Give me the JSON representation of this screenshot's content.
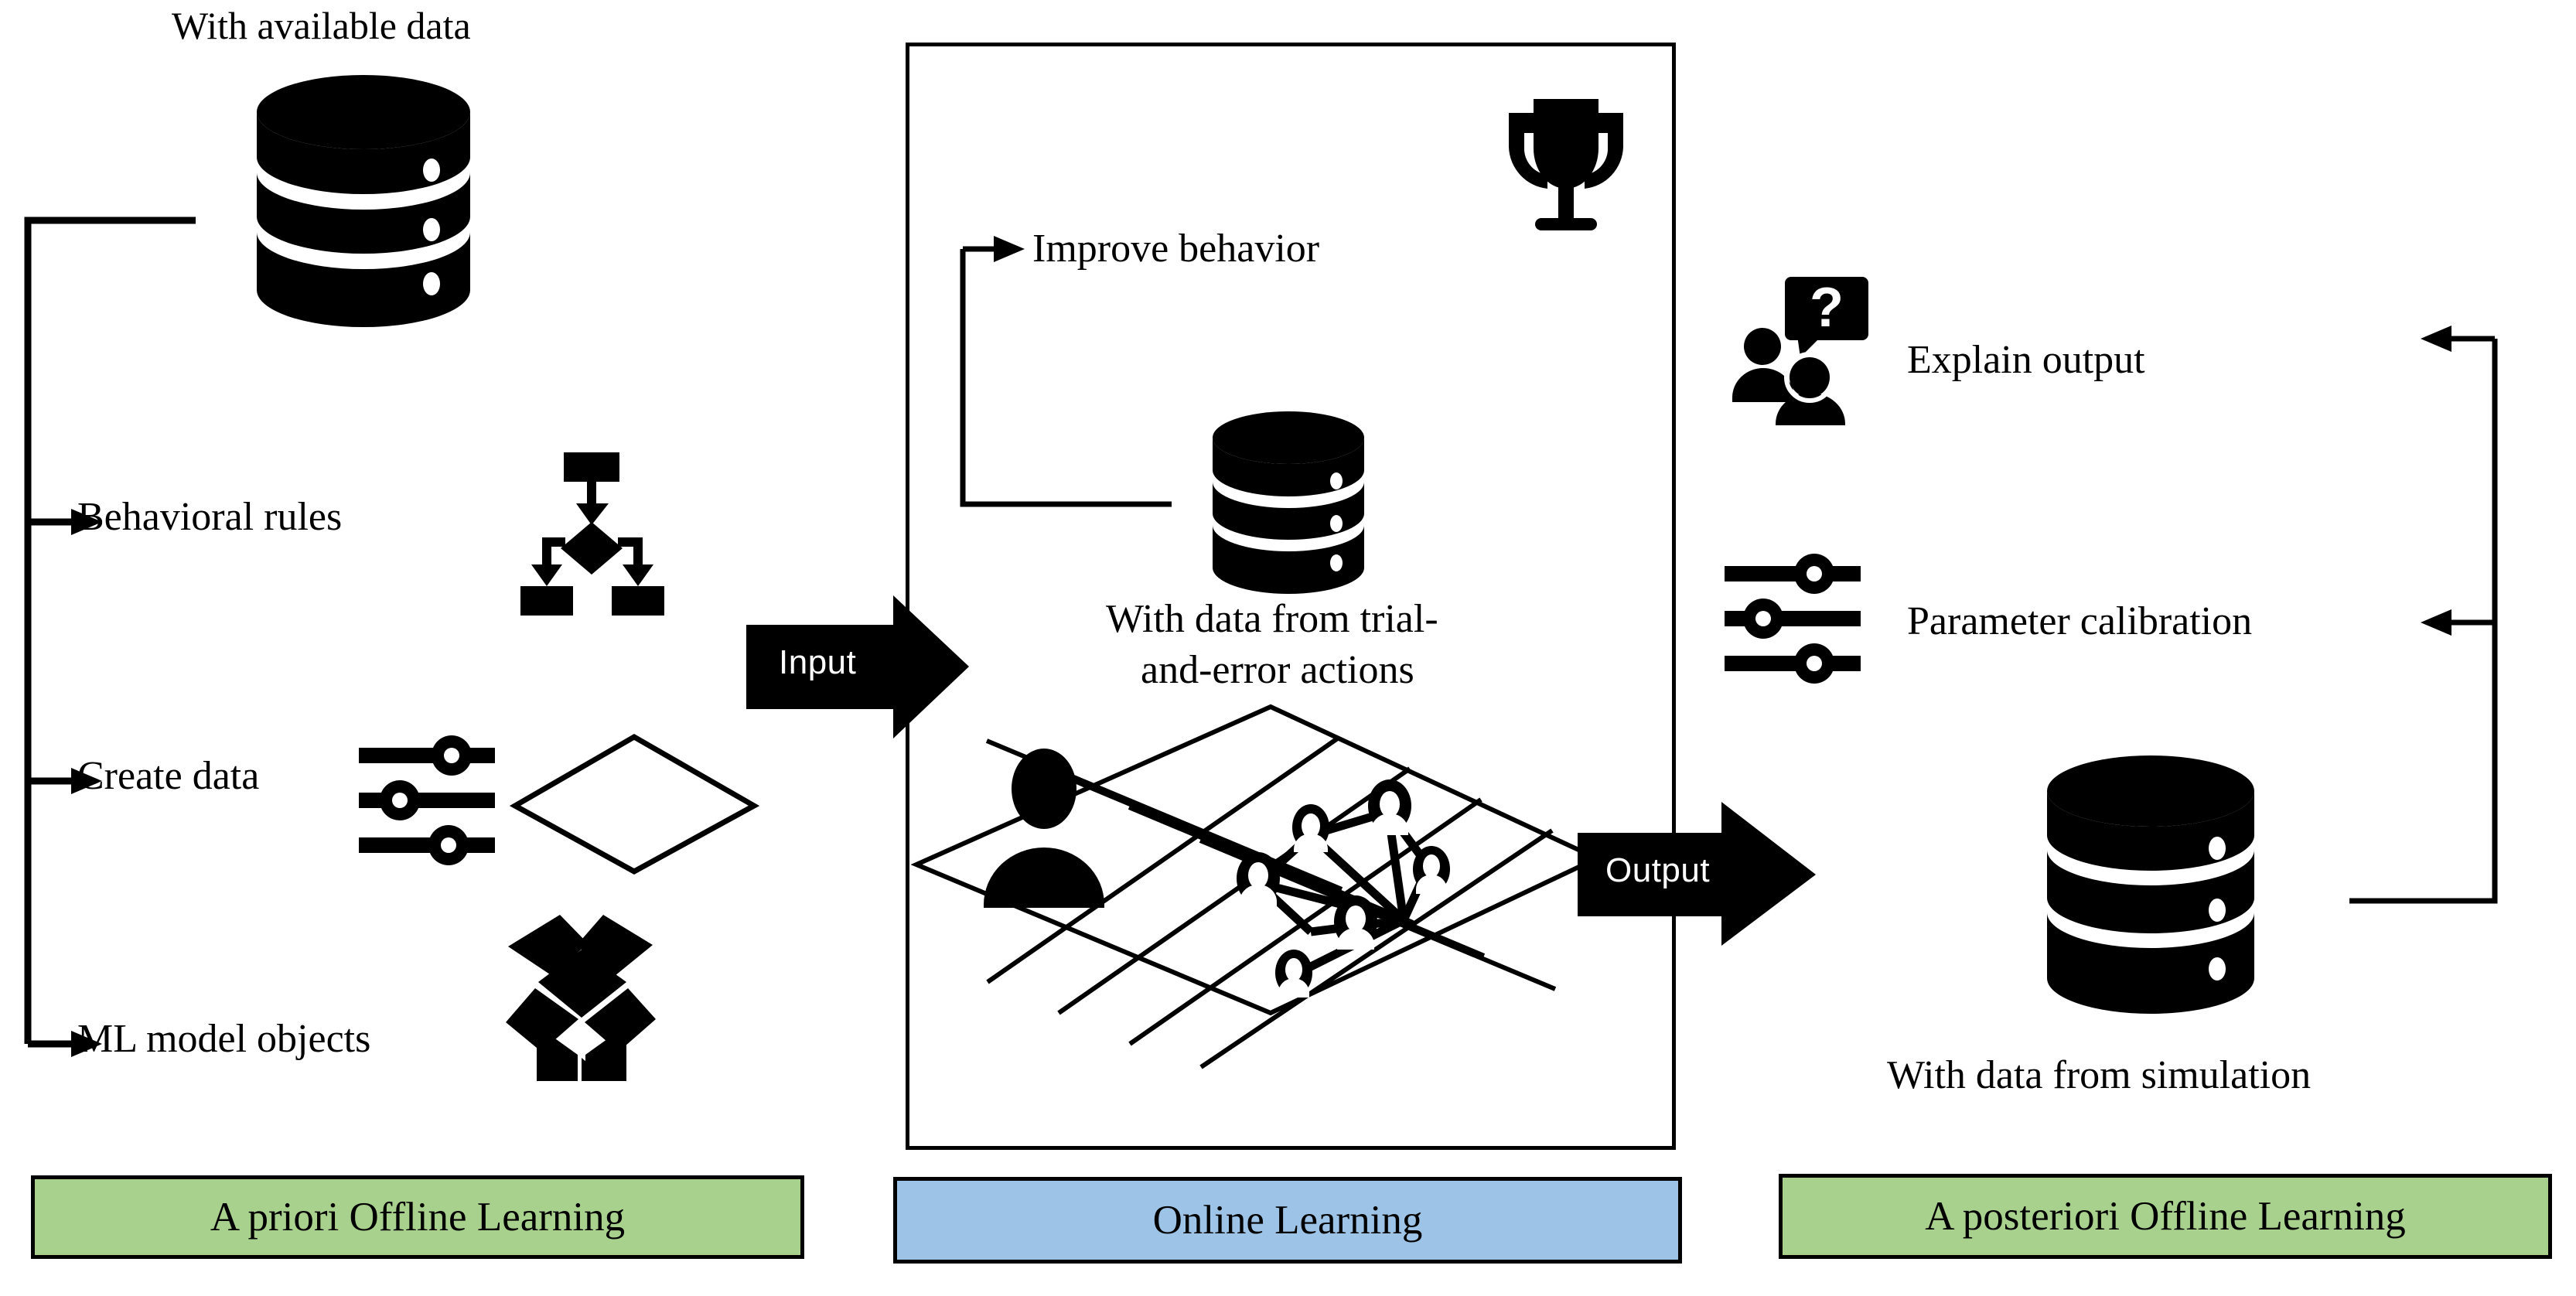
{
  "diagram": {
    "title_hidden": "Agent-based learning pipeline",
    "left_column": {
      "header_label": "With available data",
      "items": [
        {
          "label": "Behavioral rules",
          "icon": "flowchart-icon"
        },
        {
          "label": "Create data",
          "icon": "sliders-icon"
        },
        {
          "label": "ML model objects",
          "icon": "open-box-icon"
        }
      ],
      "database_icon": "database-icon",
      "diamond_icon": "diamond-outline-icon",
      "banner_label": "A priori Offline Learning",
      "banner_color": "#A9D18E"
    },
    "center_column": {
      "feedback_label": "Improve behavior",
      "trophy_icon": "trophy-icon",
      "database_icon": "database-icon",
      "database_caption_line1": "With data from trial-",
      "database_caption_line2": "and-error actions",
      "grid_icon": "isometric-grid-icon",
      "person_icon": "person-icon",
      "agent_network_icon": "agent-network-icon",
      "banner_label": "Online Learning",
      "banner_color": "#9DC3E6"
    },
    "right_column": {
      "items": [
        {
          "label": "Explain output",
          "icon": "people-question-icon"
        },
        {
          "label": "Parameter calibration",
          "icon": "sliders-icon"
        }
      ],
      "database_icon": "database-icon",
      "database_caption": "With data from simulation",
      "banner_label": "A posteriori Offline Learning",
      "banner_color": "#A9D18E"
    },
    "flow_arrows": {
      "input_label": "Input",
      "output_label": "Output"
    },
    "colors": {
      "stroke": "#000000",
      "background": "#ffffff",
      "arrow_text": "#ffffff",
      "green": "#A9D18E",
      "blue": "#9DC3E6"
    }
  }
}
